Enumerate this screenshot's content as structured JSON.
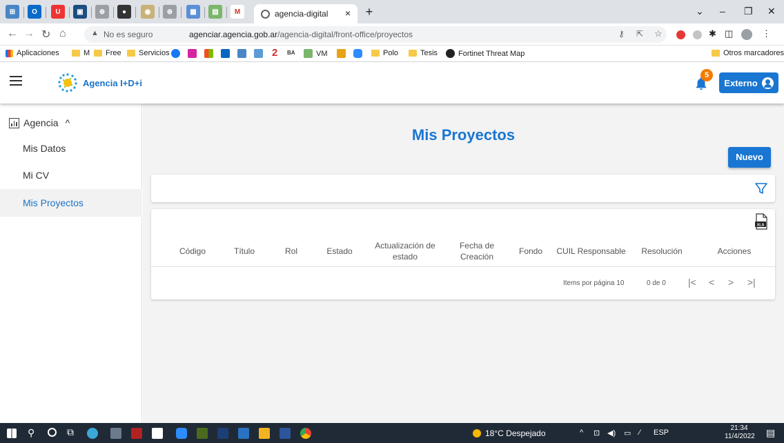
{
  "browser": {
    "tab_title": "agencia-digital",
    "tab_close": "×",
    "new_tab": "+",
    "security_label": "No es seguro",
    "url_host": "agenciar.agencia.gob.ar",
    "url_path": "/agencia-digital/front-office/proyectos",
    "bookmarks": [
      "Aplicaciones",
      "M",
      "Free",
      "Servicios",
      "VM",
      "Polo",
      "Tesis",
      "Fortinet Threat Map"
    ],
    "other_bookmarks": "Otros marcadores"
  },
  "app": {
    "brand": "Agencia I+D+i",
    "notifications_count": "5",
    "user_button": "Externo"
  },
  "sidebar": {
    "section": "Agencia",
    "section_chevron": "^",
    "items": [
      {
        "label": "Mis Datos"
      },
      {
        "label": "Mi CV"
      },
      {
        "label": "Mis Proyectos"
      }
    ]
  },
  "main": {
    "title": "Mis Proyectos",
    "new_button": "Nuevo",
    "columns": [
      {
        "l1": "Código",
        "l2": ""
      },
      {
        "l1": "Título",
        "l2": ""
      },
      {
        "l1": "Rol",
        "l2": ""
      },
      {
        "l1": "Estado",
        "l2": ""
      },
      {
        "l1": "Actualización de",
        "l2": "estado"
      },
      {
        "l1": "Fecha de",
        "l2": "Creación"
      },
      {
        "l1": "Fondo",
        "l2": ""
      },
      {
        "l1": "CUIL Responsable",
        "l2": ""
      },
      {
        "l1": "Resolución",
        "l2": ""
      },
      {
        "l1": "Acciones",
        "l2": ""
      }
    ],
    "paginator": {
      "items_per_page": "Items por página 10",
      "range": "0 de 0",
      "first": "|<",
      "prev": "<",
      "next": ">",
      "last": ">|"
    }
  },
  "taskbar": {
    "weather": "18°C Despejado",
    "lang": "ESP",
    "time": "21:34",
    "date": "11/4/2022"
  },
  "colors": {
    "primary": "#1976d2",
    "badge": "#f57c00",
    "content_bg": "#f3f3f3",
    "taskbar": "#202a36"
  }
}
